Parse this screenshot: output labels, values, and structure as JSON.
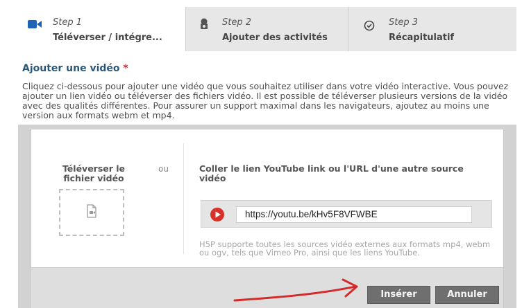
{
  "steps": [
    {
      "number": "Step 1",
      "label": "Téléverser / intégre...",
      "icon": "video-camera-icon"
    },
    {
      "number": "Step 2",
      "label": "Ajouter des activités",
      "icon": "puzzle-icon"
    },
    {
      "number": "Step 3",
      "label": "Récapitulatif",
      "icon": "check-circle-icon"
    }
  ],
  "section": {
    "title": "Ajouter une vidéo",
    "required_mark": "*",
    "description": "Cliquez ci-dessous pour ajouter une vidéo que vous souhaitez utiliser dans votre vidéo interactive. Vous pouvez ajouter un lien vidéo ou téléverser des fichiers vidéo. Il est possible de téléverser plusieurs versions de la vidéo avec des qualités différentes. Pour assurer un support maximal dans les navigateurs, ajoutez au moins une version aux formats webm et mp4."
  },
  "modal": {
    "upload_title": "Téléverser le fichier vidéo",
    "or_label": "ou",
    "paste_title": "Coller le lien YouTube link ou l'URL d'une autre source vidéo",
    "url_value": "https://youtu.be/kHv5F8VFWBE",
    "hint": "H5P supporte toutes les sources vidéo externes aux formats mp4, webm ou ogv, tels que Vimeo Pro, ainsi que les liens YouTube.",
    "insert_label": "Insérer",
    "cancel_label": "Annuler"
  },
  "colors": {
    "accent": "#2d5878",
    "required": "#c03030",
    "annotation_arrow": "#d42a2a",
    "youtube_red": "#d83128"
  }
}
